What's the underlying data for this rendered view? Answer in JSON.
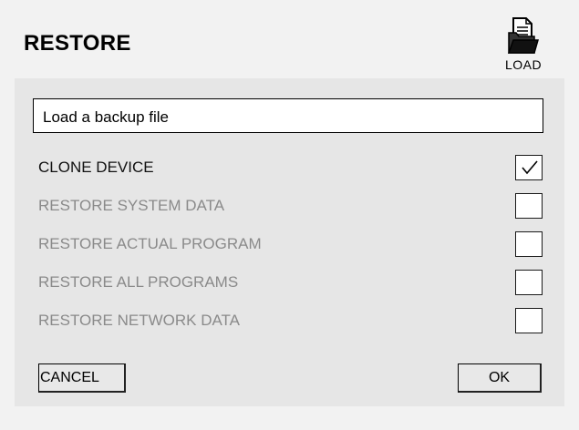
{
  "dialog": {
    "title": "RESTORE",
    "load_button": {
      "icon": "open-folder-document-icon",
      "label": "LOAD"
    },
    "file_field": {
      "value": "Load a backup file"
    },
    "options": [
      {
        "label": "CLONE DEVICE",
        "checked": true,
        "enabled": true
      },
      {
        "label": "RESTORE SYSTEM DATA",
        "checked": false,
        "enabled": false
      },
      {
        "label": "RESTORE ACTUAL PROGRAM",
        "checked": false,
        "enabled": false
      },
      {
        "label": "RESTORE ALL PROGRAMS",
        "checked": false,
        "enabled": false
      },
      {
        "label": "RESTORE NETWORK DATA",
        "checked": false,
        "enabled": false
      }
    ],
    "cancel_label": "CANCEL",
    "ok_label": "OK"
  },
  "colors": {
    "dialog_bg": "#f2f2f2",
    "panel_bg": "#e6e6e6",
    "enabled_text": "#111111",
    "disabled_text": "#8a8a8a"
  }
}
